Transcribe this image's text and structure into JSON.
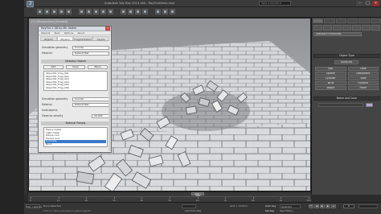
{
  "window": {
    "title": "Autodesk 3ds Max 2014 x64 - RayFireDemo.max",
    "app_logo": "3",
    "search_placeholder": "Type a keyword",
    "controls": {
      "minimize": "–",
      "maximize": "□",
      "close": "×"
    }
  },
  "viewport": {
    "label": "[+] [Perspective] [Shaded]"
  },
  "rayfire": {
    "title": "RayFire 1.58 by Mir Vadim",
    "close": "×",
    "menu": [
      "Objects",
      "Tools",
      "Options",
      "About"
    ],
    "tabs": [
      "Objects",
      "Physics",
      "Fragmentation",
      "Layers"
    ],
    "rows": [
      {
        "label": "Simulation geometry",
        "value": "Convex"
      },
      {
        "label": "Material",
        "value": "Default Mat"
      }
    ],
    "sleeping_header": "Sleeping Objects",
    "sleeping_buttons": [
      "Add",
      "Clear",
      "Menu"
    ],
    "sleeping_list": [
      "Object01_Frag_001",
      "Object01_Frag_002",
      "Object01_Frag_003",
      "Object01_Frag_004",
      "Object01_Frag_005",
      "Object01_Frag_006"
    ],
    "rows2": [
      {
        "label": "Simulation geometry",
        "value": "Convex"
      },
      {
        "label": "Material",
        "value": "Default Mat"
      },
      {
        "label": "Solid objects",
        "value": ""
      },
      {
        "label": "Sleep by velocity",
        "value": "20,000"
      }
    ],
    "material_header": "Material Presets",
    "material_list": [
      "Heavy metal",
      "Light metal",
      "Dense rock",
      "Porous rock",
      "Concrete",
      "Brick"
    ],
    "material_selected": "Concrete"
  },
  "command_panel": {
    "dropdown": "Standard Primitives",
    "object_type": "Object Type",
    "autogrid": "AutoGrid",
    "buttons": [
      "Box",
      "Cone",
      "Sphere",
      "GeoSphere",
      "Cylinder",
      "Tube",
      "Torus",
      "Pyramid",
      "Teapot",
      "Plane"
    ],
    "name_color": "Name and Color",
    "swatch_color": "#b8a6d9"
  },
  "timeline": {
    "slider": "100 / 100",
    "ticks": [
      "0",
      "10",
      "20",
      "30",
      "40",
      "50",
      "60",
      "70",
      "80",
      "90",
      "100"
    ]
  },
  "status": {
    "maxscript": "Mini Listener",
    "selected": "None Selected",
    "prompt": "Click or click-and-drag to select objects",
    "grid": "Grid = 10,0cm",
    "autokey": "Auto Key",
    "set_key": "Set Key",
    "selected_dd": "Selected",
    "key_filters": "Key Filters...",
    "add_time_tag": "Add Time Tag",
    "frame": "0"
  }
}
